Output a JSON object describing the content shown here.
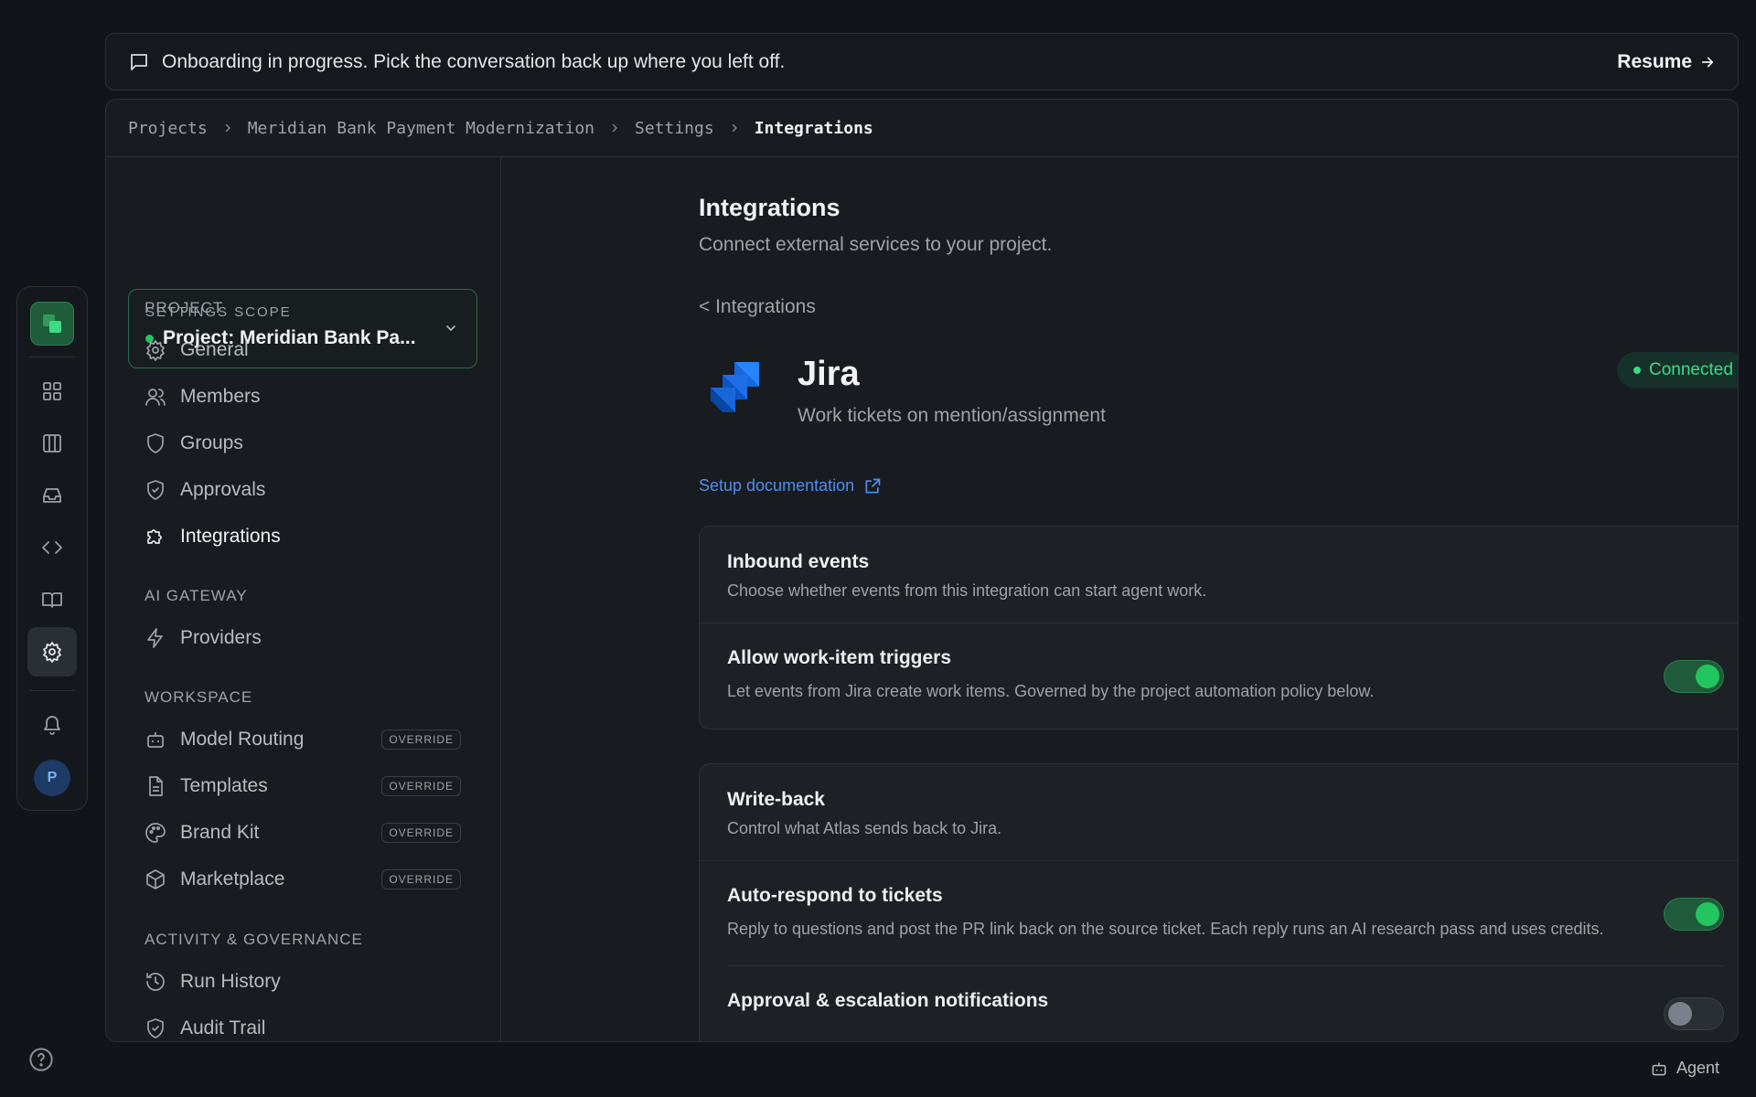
{
  "banner": {
    "message": "Onboarding in progress. Pick the conversation back up where you left off.",
    "action_label": "Resume"
  },
  "rail": {
    "avatar_initial": "P",
    "icons": [
      "logo-icon",
      "grid-icon",
      "board-icon",
      "inbox-icon",
      "code-icon",
      "book-icon",
      "gear-icon",
      "bell-icon"
    ]
  },
  "breadcrumb": [
    "Projects",
    "Meridian Bank Payment Modernization",
    "Settings",
    "Integrations"
  ],
  "scope": {
    "label": "SETTINGS SCOPE",
    "value": "Project: Meridian Bank Pa..."
  },
  "nav": {
    "project_label": "PROJECT",
    "project_items": [
      "General",
      "Members",
      "Groups",
      "Approvals",
      "Integrations"
    ],
    "gateway_label": "AI GATEWAY",
    "gateway_items": [
      "Providers"
    ],
    "workspace_label": "WORKSPACE",
    "workspace_items": [
      "Model Routing",
      "Templates",
      "Brand Kit",
      "Marketplace"
    ],
    "override_label": "OVERRIDE",
    "activity_label": "ACTIVITY & GOVERNANCE",
    "activity_items": [
      "Run History",
      "Audit Trail"
    ]
  },
  "page": {
    "title": "Integrations",
    "subtitle": "Connect external services to your project.",
    "back_label": "< Integrations"
  },
  "integration": {
    "name": "Jira",
    "description": "Work tickets on mention/assignment",
    "status": "Connected",
    "status_color": "#3ddc84",
    "docs_label": "Setup documentation"
  },
  "inbound": {
    "title": "Inbound events",
    "subtitle": "Choose whether events from this integration can start agent work.",
    "rows": [
      {
        "title": "Allow work-item triggers",
        "desc": "Let events from Jira create work items. Governed by the project automation policy below.",
        "enabled": true
      }
    ]
  },
  "writeback": {
    "title": "Write-back",
    "subtitle": "Control what Atlas sends back to Jira.",
    "rows": [
      {
        "title": "Auto-respond to tickets",
        "desc": "Reply to questions and post the PR link back on the source ticket. Each reply runs an AI research pass and uses credits.",
        "enabled": true
      },
      {
        "title": "Approval & escalation notifications",
        "desc": "",
        "enabled": false
      }
    ]
  },
  "footer": {
    "agent_label": "Agent"
  },
  "colors": {
    "accent": "#22c55e",
    "link": "#4f8ff0",
    "background": "#111419"
  }
}
